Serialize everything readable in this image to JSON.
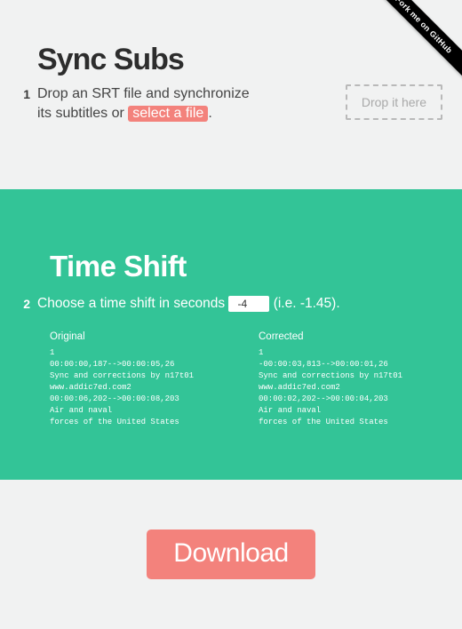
{
  "ribbon": {
    "label": "Fork me on GitHub"
  },
  "section1": {
    "title": "Sync Subs",
    "step_num": "1",
    "desc_before": "Drop an SRT file and synchronize its subtitles or ",
    "select_label": "select a file",
    "desc_after": ".",
    "dropzone_label": "Drop it here"
  },
  "section2": {
    "title": "Time Shift",
    "step_num": "2",
    "desc_before": "Choose a time shift in seconds ",
    "shift_value": "-4",
    "desc_after": " (i.e. -1.45).",
    "preview": {
      "original_title": "Original",
      "corrected_title": "Corrected",
      "original_body": "1\n00:00:00,187-->00:00:05,26\nSync and corrections by n17t01\nwww.addic7ed.com2\n00:00:06,202-->00:00:08,203\nAir and naval\nforces of the United States",
      "corrected_body": "1\n-00:00:03,813-->00:00:01,26\nSync and corrections by n17t01\nwww.addic7ed.com2\n00:00:02,202-->00:00:04,203\nAir and naval\nforces of the United States"
    }
  },
  "download": {
    "label": "Download"
  }
}
